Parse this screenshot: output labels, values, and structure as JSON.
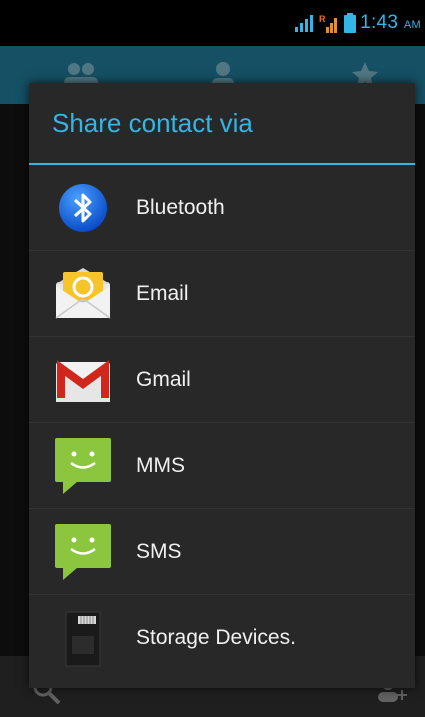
{
  "status_bar": {
    "time": "1:43",
    "ampm": "AM"
  },
  "dialog": {
    "title": "Share contact via",
    "items": [
      {
        "label": "Bluetooth",
        "icon": "bluetooth-icon"
      },
      {
        "label": "Email",
        "icon": "email-icon"
      },
      {
        "label": "Gmail",
        "icon": "gmail-icon"
      },
      {
        "label": "MMS",
        "icon": "mms-icon"
      },
      {
        "label": "SMS",
        "icon": "sms-icon"
      },
      {
        "label": "Storage Devices.",
        "icon": "sd-card-icon"
      }
    ]
  },
  "colors": {
    "accent": "#33b5e5",
    "dialog_bg": "#282828",
    "status_bar_bg": "#000000",
    "action_bar_bg": "#1d6b86"
  }
}
